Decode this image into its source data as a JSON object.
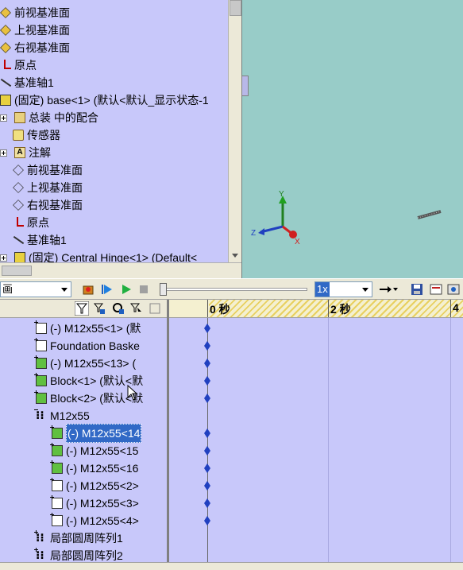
{
  "top_tree": {
    "items": [
      {
        "label": "前视基准面",
        "icon": "plane-icon"
      },
      {
        "label": "上视基准面",
        "icon": "plane-icon"
      },
      {
        "label": "右视基准面",
        "icon": "plane-icon"
      },
      {
        "label": "原点",
        "icon": "origin-icon"
      },
      {
        "label": "基准轴1",
        "icon": "axis-icon"
      },
      {
        "label": "(固定) base<1> (默认<默认_显示状态-1",
        "icon": "part-icon"
      },
      {
        "label": "总装 中的配合",
        "icon": "mates-folder-icon"
      },
      {
        "label": "传感器",
        "icon": "sensor-icon"
      },
      {
        "label": "注解",
        "icon": "annotation-icon"
      },
      {
        "label": "前视基准面",
        "icon": "plane-icon"
      },
      {
        "label": "上视基准面",
        "icon": "plane-icon"
      },
      {
        "label": "右视基准面",
        "icon": "plane-icon"
      },
      {
        "label": "原点",
        "icon": "origin-icon"
      },
      {
        "label": "基准轴1",
        "icon": "axis-icon"
      },
      {
        "label": "(固定) Central Hinge<1> (Default<",
        "icon": "part-icon"
      }
    ]
  },
  "toolbar": {
    "mode_value": "画",
    "speed_value": "1x"
  },
  "triad": {
    "x_label": "X",
    "y_label": "Y",
    "z_label": "Z"
  },
  "timeline": {
    "ticks": [
      "0 秒",
      "2 秒",
      "4"
    ]
  },
  "bottom_tree": {
    "items": [
      {
        "label": "(-) M12x55<1> (默",
        "icon": "part-icon",
        "indent": 1
      },
      {
        "label": "Foundation Baske",
        "icon": "part-icon",
        "indent": 1
      },
      {
        "label": "(-) M12x55<13> (",
        "icon": "part-icon-green",
        "indent": 1
      },
      {
        "label": "Block<1> (默认<默",
        "icon": "part-icon-green",
        "indent": 1
      },
      {
        "label": "Block<2> (默认<默",
        "icon": "part-icon-green",
        "indent": 1
      },
      {
        "label": "M12x55",
        "icon": "pattern-icon",
        "indent": 1
      },
      {
        "label": "(-) M12x55<14",
        "icon": "part-icon-green",
        "indent": 2,
        "selected": true
      },
      {
        "label": "(-) M12x55<15",
        "icon": "part-icon-green",
        "indent": 2
      },
      {
        "label": "(-) M12x55<16",
        "icon": "part-icon-green",
        "indent": 2
      },
      {
        "label": "(-) M12x55<2>",
        "icon": "part-icon",
        "indent": 2
      },
      {
        "label": "(-) M12x55<3>",
        "icon": "part-icon",
        "indent": 2
      },
      {
        "label": "(-) M12x55<4>",
        "icon": "part-icon",
        "indent": 2
      },
      {
        "label": "局部圆周阵列1",
        "icon": "pattern-icon",
        "indent": 1
      },
      {
        "label": "局部圆周阵列2",
        "icon": "pattern-icon",
        "indent": 1
      }
    ]
  }
}
